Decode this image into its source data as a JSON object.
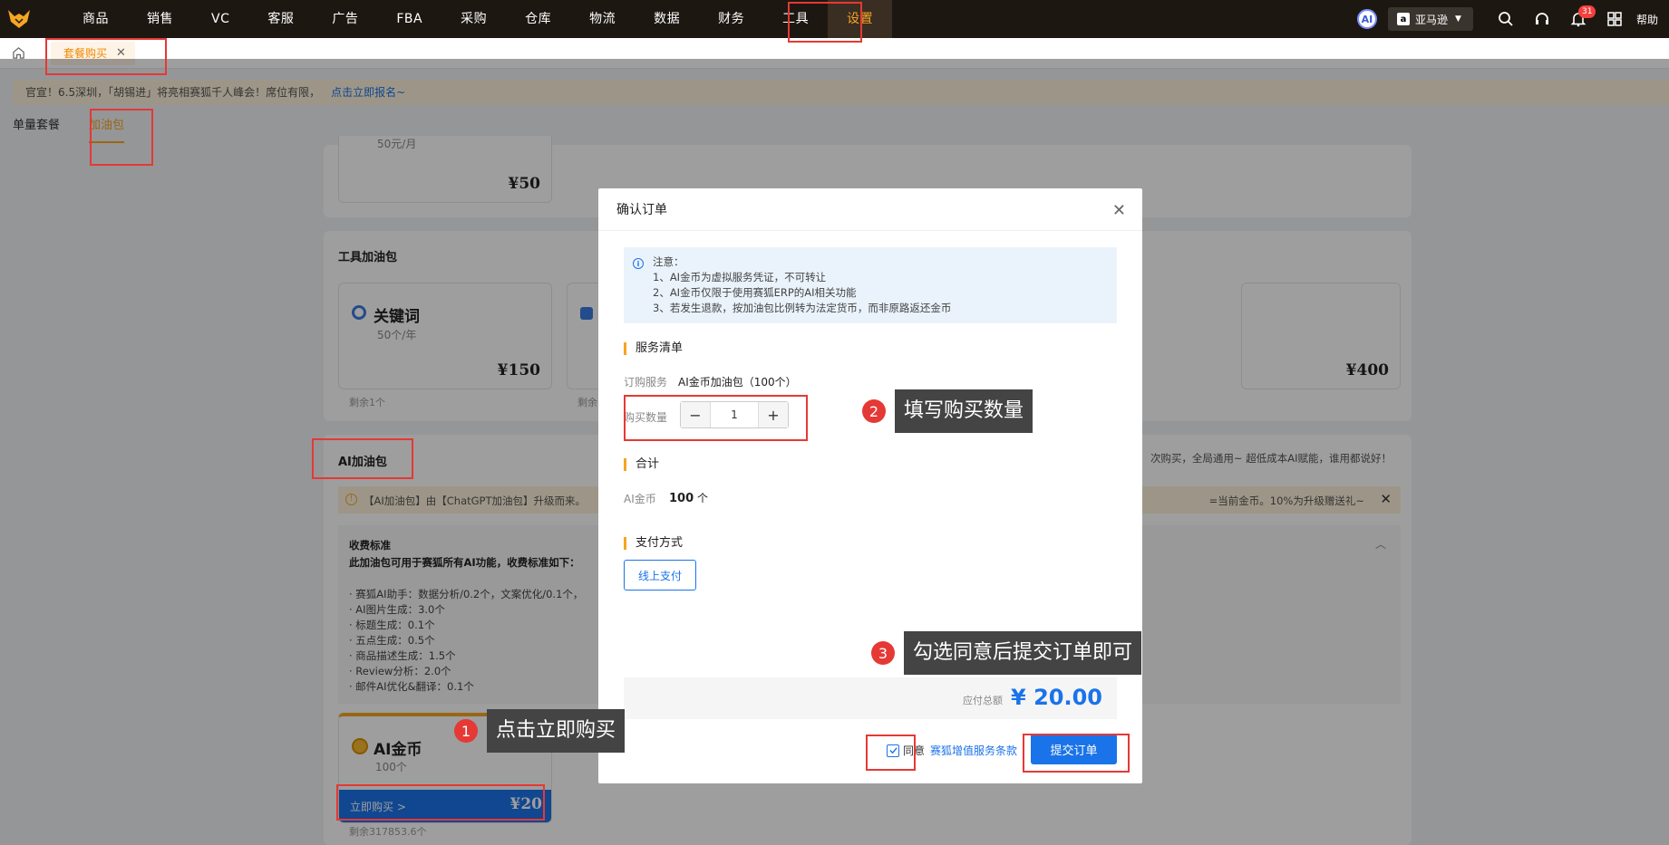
{
  "nav": {
    "items": [
      "商品",
      "销售",
      "VC",
      "客服",
      "广告",
      "FBA",
      "采购",
      "仓库",
      "物流",
      "数据",
      "财务",
      "工具",
      "设置"
    ],
    "active_index": 12,
    "ai_label": "AI",
    "store": "亚马逊",
    "notification_count": "31",
    "help": "帮助"
  },
  "tabbar": {
    "page_tab": "套餐购买"
  },
  "announce": {
    "text": "官宣！6.5深圳，「胡锡进」将亮相赛狐千人峰会！席位有限，",
    "link": "点击立即报名~"
  },
  "subtabs": [
    "单量套餐",
    "加油包"
  ],
  "top_card": {
    "sub": "50元/月",
    "price": "¥50"
  },
  "tool_section": {
    "title": "工具加油包",
    "card1": {
      "title": "关键词",
      "sub": "50个/年",
      "price": "¥150",
      "remain": "剩余1个"
    },
    "card2_remain": "剩余",
    "card3_price": "¥400"
  },
  "ai_section": {
    "title": "AI加油包",
    "right_text": "次购买，全局通用~ 超低成本AI赋能，谁用都说好！",
    "notice_left": "【AI加油包】由【ChatGPT加油包】升级而来。",
    "notice_right": "=当前金币。10%为升级赠送礼~",
    "fee_title": "收费标准",
    "fee_desc": "此加油包可用于赛狐所有AI功能，收费标准如下：",
    "fee_items": [
      "· 赛狐AI助手：数据分析/0.2个，文案优化/0.1个，",
      "· AI图片生成：3.0个",
      "· 标题生成：0.1个",
      "· 五点生成：0.5个",
      "· 商品描述生成：1.5个",
      "· Review分析：2.0个",
      "· 邮件AI优化&翻译：0.1个"
    ],
    "coin_card": {
      "title": "AI金币",
      "sub": "100个",
      "buy": "立即购买 >",
      "price": "¥20",
      "remain": "剩余317853.6个"
    }
  },
  "modal": {
    "title": "确认订单",
    "note_title": "注意：",
    "notes": [
      "1、AI金币为虚拟服务凭证，不可转让",
      "2、AI金币仅限于使用赛狐ERP的AI相关功能",
      "3、若发生退款，按加油包比例转为法定货币，而非原路返还金币"
    ],
    "service_title": "服务清单",
    "service_label": "订购服务",
    "service_value": "AI金币加油包（100个）",
    "qty_label": "购买数量",
    "qty_value": "1",
    "sum_title": "合计",
    "sum_label": "AI金币",
    "sum_value": "100",
    "sum_unit": "个",
    "pay_title": "支付方式",
    "pay_option": "线上支付",
    "total_label": "应付总额",
    "total_amount": "¥ 20.00",
    "agree_label": "同意",
    "agree_link": "赛狐增值服务条款",
    "submit": "提交订单"
  },
  "callouts": [
    {
      "num": "1",
      "text": "点击立即购买"
    },
    {
      "num": "2",
      "text": "填写购买数量"
    },
    {
      "num": "3",
      "text": "勾选同意后提交订单即可"
    }
  ],
  "colors": {
    "accent": "#f5a623",
    "primary": "#1a73e8",
    "annotation": "#e53935",
    "nav_bg": "#1d1712"
  }
}
